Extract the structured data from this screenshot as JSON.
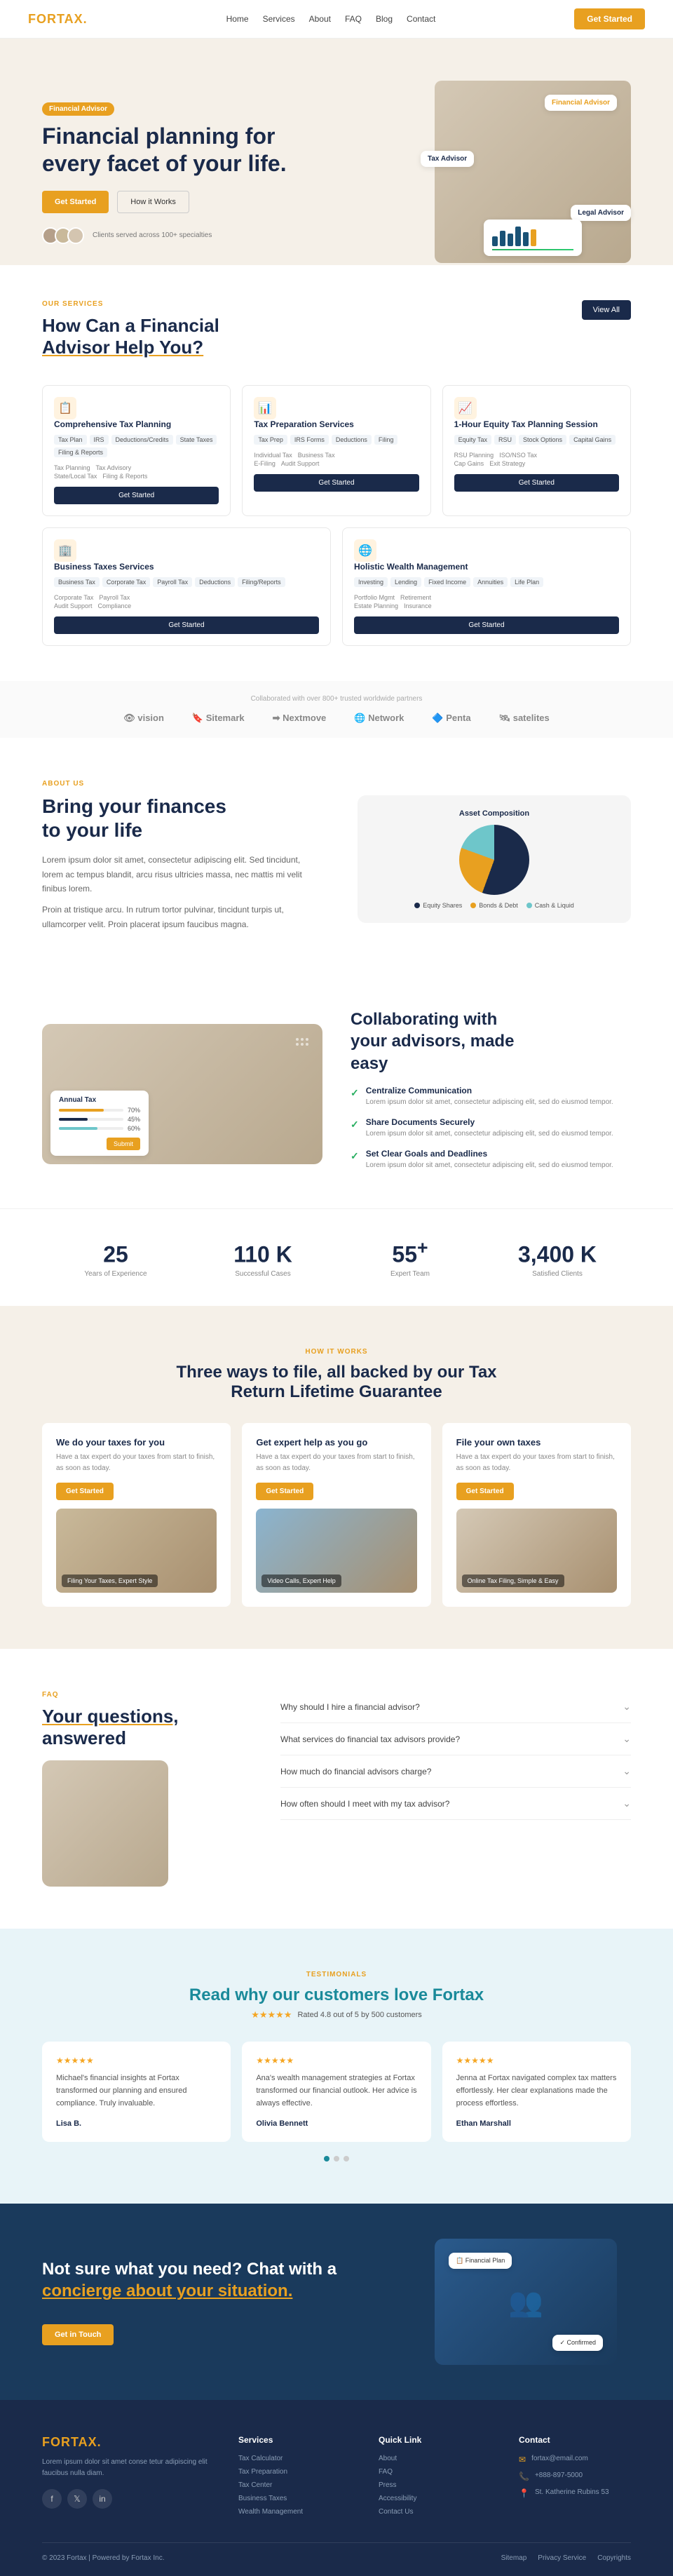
{
  "nav": {
    "logo": "FORTAX",
    "logo_dot": ".",
    "links": [
      "Home",
      "Services",
      "About",
      "FAQ",
      "Blog",
      "Contact"
    ],
    "cta": "Get Started"
  },
  "hero": {
    "badge": "Financial Advisor",
    "headline_line1": "Financial planning for",
    "headline_line2": "every facet of your life.",
    "btn_start": "Get Started",
    "btn_how": "How it Works",
    "avatars_text": "Clients served across 100+ specialties",
    "tag_advisor": "Financial Advisor",
    "tag_tax": "Tax Advisor",
    "tag_legal": "Legal Advisor"
  },
  "services": {
    "section_label": "Our Services",
    "title_line1": "How Can a Financial",
    "title_line2": "Advisor Help You?",
    "view_all": "View All",
    "cards": [
      {
        "icon": "📋",
        "title": "Comprehensive Tax Planning",
        "tags": [
          "Tax Plan",
          "IRS",
          "Deductions/Credits",
          "State Taxes",
          "Filing & Reports"
        ],
        "rows": [
          [
            "Tax Planning",
            "Tax Advisory"
          ],
          [
            "State/Local Tax",
            "Filing & Reports"
          ]
        ],
        "btn": "Get Started"
      },
      {
        "icon": "📊",
        "title": "Tax Preparation Services",
        "tags": [
          "Tax Prep",
          "IRS Forms",
          "Deductions",
          "Filing"
        ],
        "rows": [
          [
            "Individual Tax",
            "Business Tax"
          ],
          [
            "E-Filing",
            "Audit Support"
          ]
        ],
        "btn": "Get Started"
      },
      {
        "icon": "📈",
        "title": "1-Hour Equity Tax Planning Session",
        "tags": [
          "Equity Tax",
          "RSU",
          "Stock Options",
          "Capital Gains"
        ],
        "rows": [
          [
            "RSU Planning",
            "ISO/NSO Tax"
          ],
          [
            "Cap Gains",
            "Exit Strategy"
          ]
        ],
        "btn": "Get Started"
      },
      {
        "icon": "🏢",
        "title": "Business Taxes Services",
        "tags": [
          "Business Tax",
          "Corporate Tax",
          "Payroll Tax",
          "Deductions",
          "Filing/Reports"
        ],
        "rows": [
          [
            "Corporate Tax",
            "Payroll Tax"
          ],
          [
            "Audit Support",
            "Compliance"
          ]
        ],
        "btn": "Get Started"
      },
      {
        "icon": "🌐",
        "title": "Holistic Wealth Management",
        "tags": [
          "Investing",
          "Lending",
          "Fixed Income",
          "Annuities",
          "Life Plan"
        ],
        "rows": [
          [
            "Portfolio Mgmt",
            "Retirement"
          ],
          [
            "Estate Planning",
            "Insurance"
          ]
        ],
        "btn": "Get Started"
      }
    ]
  },
  "partners": {
    "label": "Collaborated with over 800+ trusted worldwide partners",
    "logos": [
      "vision",
      "Sitemark",
      "Nextmove",
      "Network",
      "Penta",
      "satelites"
    ]
  },
  "about": {
    "section_label": "About Us",
    "title_line1": "Bring your finances",
    "title_line2": "to your life",
    "description1": "Lorem ipsum dolor sit amet, consectetur adipiscing elit. Sed tincidunt, lorem ac tempus blandit, arcu risus ultricies massa, nec mattis mi velit finibus lorem.",
    "description2": "Proin at tristique arcu. In rutrum tortor pulvinar, tincidunt turpis ut, ullamcorper velit. Proin placerat ipsum faucibus magna.",
    "chart_label": "Asset Composition",
    "legend": [
      "Equity Shares",
      "Bonds & Debt",
      "Cash & Liquid"
    ]
  },
  "collab": {
    "title_line1": "Collaborating with",
    "title_line2": "your advisors, made",
    "title_line3": "easy",
    "annual_tax": "Annual Tax",
    "features": [
      {
        "icon": "✓",
        "title": "Centralize Communication",
        "desc": "Lorem ipsum dolor sit amet, consectetur adipiscing elit, sed do eiusmod tempor."
      },
      {
        "icon": "✓",
        "title": "Share Documents Securely",
        "desc": "Lorem ipsum dolor sit amet, consectetur adipiscing elit, sed do eiusmod tempor."
      },
      {
        "icon": "✓",
        "title": "Set Clear Goals and Deadlines",
        "desc": "Lorem ipsum dolor sit amet, consectetur adipiscing elit, sed do eiusmod tempor."
      }
    ]
  },
  "stats": [
    {
      "num": "25",
      "suffix": "",
      "label": "Years of Experience"
    },
    {
      "num": "110 K",
      "suffix": "",
      "label": "Successful Cases"
    },
    {
      "num": "55",
      "suffix": "+",
      "label": "Expert Team"
    },
    {
      "num": "3,400 K",
      "suffix": "",
      "label": "Satisfied Clients"
    }
  ],
  "three_ways": {
    "section_label": "How it Works",
    "title_line1": "Three ways to file, all backed by our Tax",
    "title_line2": "Return Lifetime Guarantee",
    "cards": [
      {
        "title": "We do your taxes for you",
        "desc": "Have a tax expert do your taxes from start to finish, as soon as today.",
        "btn": "Get Started",
        "img_caption": "Filing Your Taxes, Expert Style"
      },
      {
        "title": "Get expert help as you go",
        "desc": "Have a tax expert do your taxes from start to finish, as soon as today.",
        "btn": "Get Started",
        "img_caption": "Video Calls, Expert Help"
      },
      {
        "title": "File your own taxes",
        "desc": "Have a tax expert do your taxes from start to finish, as soon as today.",
        "btn": "Get Started",
        "img_caption": "Online Tax Filing, Simple & Easy"
      }
    ]
  },
  "faq": {
    "section_label": "FAQ",
    "title_line1": "Your questions,",
    "title_line2": "answered",
    "items": [
      "Why should I hire a financial advisor?",
      "What services do financial tax advisors provide?",
      "How much do financial advisors charge?",
      "How often should I meet with my tax advisor?"
    ]
  },
  "testimonials": {
    "section_label": "Testimonials",
    "title_line1": "Read why our customers",
    "title_highlight": "love Fortax",
    "rating_text": "Rated 4.8 out of 5 by 500 customers",
    "cards": [
      {
        "stars": "★★★★★",
        "text": "Michael's financial insights at Fortax transformed our planning and ensured compliance. Truly invaluable.",
        "author": "Lisa B."
      },
      {
        "stars": "★★★★★",
        "text": "Ana's wealth management strategies at Fortax transformed our financial outlook. Her advice is always effective.",
        "author": "Olivia Bennett"
      },
      {
        "stars": "★★★★★",
        "text": "Jenna at Fortax navigated complex tax matters effortlessly. Her clear explanations made the process effortless.",
        "author": "Ethan Marshall"
      }
    ],
    "dots": [
      "active",
      "",
      ""
    ]
  },
  "cta": {
    "headline_line1": "Not sure what you need? Chat with a",
    "headline_highlight": "concierge about your situation.",
    "btn": "Get in Touch"
  },
  "footer": {
    "logo": "FORTAX",
    "logo_dot": ".",
    "desc": "Lorem ipsum dolor sit amet conse tetur adipiscing elit faucibus nulla diam.",
    "services_title": "Services",
    "services_links": [
      "Tax Calculator",
      "Tax Preparation",
      "Tax Center",
      "Business Taxes",
      "Wealth Management"
    ],
    "quicklinks_title": "Quick Link",
    "quicklinks": [
      "About",
      "FAQ",
      "Press",
      "Accessibility",
      "Contact Us"
    ],
    "contact_title": "Contact",
    "contact_items": [
      {
        "icon": "✉",
        "text": "fortax@email.com"
      },
      {
        "icon": "📞",
        "text": "+888-897-5000"
      },
      {
        "icon": "📍",
        "text": "St. Katherine Rubins 53"
      }
    ],
    "copyright": "© 2023 Fortax | Powered by Fortax Inc.",
    "bottom_links": [
      "Sitemap",
      "Privacy Service",
      "Copyrights"
    ]
  }
}
